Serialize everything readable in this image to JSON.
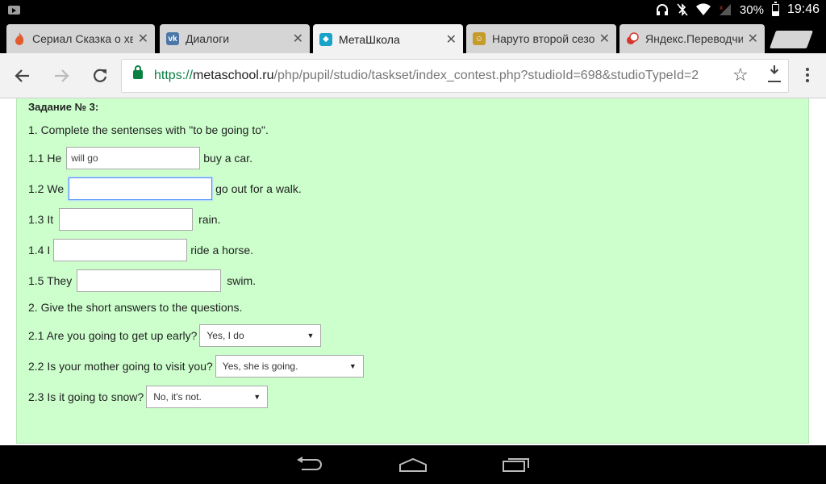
{
  "status": {
    "battery": "30%",
    "time": "19:46"
  },
  "tabs": [
    {
      "title": "Сериал Сказка о хв",
      "favicon": "red-flame",
      "color": "#e25b2c"
    },
    {
      "title": "Диалоги",
      "favicon": "vk",
      "color": "#4a76a8"
    },
    {
      "title": "МетаШкола",
      "favicon": "metaschool",
      "color": "#1aa3c8"
    },
    {
      "title": "Наруто второй сезо",
      "favicon": "naruto",
      "color": "#c59b2a"
    },
    {
      "title": "Яндекс.Переводчик",
      "favicon": "yandex-translate",
      "color": "#d7342b"
    }
  ],
  "url": {
    "scheme": "https://",
    "host": "metaschool.ru",
    "path": "/php/pupil/studio/taskset/index_contest.php?studioId=698&studioTypeId=2"
  },
  "task": {
    "title": "Задание № 3:",
    "part1": "1. Complete the sentenses with \"to be going to\".",
    "fills": [
      {
        "before": "1.1 He",
        "value": "will go",
        "after": "buy a car."
      },
      {
        "before": "1.2 We",
        "value": "",
        "after": "go out for a walk."
      },
      {
        "before": "1.3 It",
        "value": "",
        "after": "rain."
      },
      {
        "before": "1.4 I",
        "value": "",
        "after": "ride a horse."
      },
      {
        "before": "1.5 They",
        "value": "",
        "after": "swim."
      }
    ],
    "part2": "2. Give the short answers to the questions.",
    "questions": [
      {
        "q": "2.1 Are you going to get up early?",
        "answer": "Yes, I do"
      },
      {
        "q": "2.2 Is your mother going to visit you?",
        "answer": "Yes, she is going."
      },
      {
        "q": "2.3 Is it going to snow?",
        "answer": "No, it's not."
      }
    ]
  }
}
